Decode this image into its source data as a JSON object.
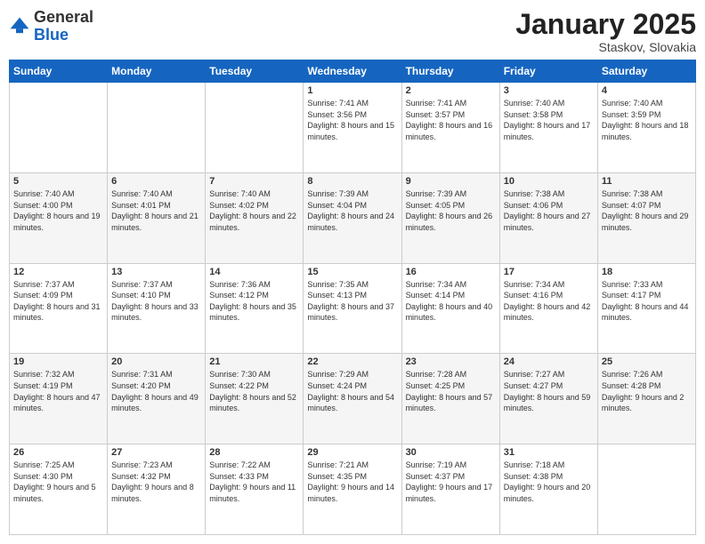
{
  "logo": {
    "general": "General",
    "blue": "Blue"
  },
  "header": {
    "month": "January 2025",
    "location": "Staskov, Slovakia"
  },
  "weekdays": [
    "Sunday",
    "Monday",
    "Tuesday",
    "Wednesday",
    "Thursday",
    "Friday",
    "Saturday"
  ],
  "rows": [
    [
      {
        "day": "",
        "sunrise": "",
        "sunset": "",
        "daylight": ""
      },
      {
        "day": "",
        "sunrise": "",
        "sunset": "",
        "daylight": ""
      },
      {
        "day": "",
        "sunrise": "",
        "sunset": "",
        "daylight": ""
      },
      {
        "day": "1",
        "sunrise": "Sunrise: 7:41 AM",
        "sunset": "Sunset: 3:56 PM",
        "daylight": "Daylight: 8 hours and 15 minutes."
      },
      {
        "day": "2",
        "sunrise": "Sunrise: 7:41 AM",
        "sunset": "Sunset: 3:57 PM",
        "daylight": "Daylight: 8 hours and 16 minutes."
      },
      {
        "day": "3",
        "sunrise": "Sunrise: 7:40 AM",
        "sunset": "Sunset: 3:58 PM",
        "daylight": "Daylight: 8 hours and 17 minutes."
      },
      {
        "day": "4",
        "sunrise": "Sunrise: 7:40 AM",
        "sunset": "Sunset: 3:59 PM",
        "daylight": "Daylight: 8 hours and 18 minutes."
      }
    ],
    [
      {
        "day": "5",
        "sunrise": "Sunrise: 7:40 AM",
        "sunset": "Sunset: 4:00 PM",
        "daylight": "Daylight: 8 hours and 19 minutes."
      },
      {
        "day": "6",
        "sunrise": "Sunrise: 7:40 AM",
        "sunset": "Sunset: 4:01 PM",
        "daylight": "Daylight: 8 hours and 21 minutes."
      },
      {
        "day": "7",
        "sunrise": "Sunrise: 7:40 AM",
        "sunset": "Sunset: 4:02 PM",
        "daylight": "Daylight: 8 hours and 22 minutes."
      },
      {
        "day": "8",
        "sunrise": "Sunrise: 7:39 AM",
        "sunset": "Sunset: 4:04 PM",
        "daylight": "Daylight: 8 hours and 24 minutes."
      },
      {
        "day": "9",
        "sunrise": "Sunrise: 7:39 AM",
        "sunset": "Sunset: 4:05 PM",
        "daylight": "Daylight: 8 hours and 26 minutes."
      },
      {
        "day": "10",
        "sunrise": "Sunrise: 7:38 AM",
        "sunset": "Sunset: 4:06 PM",
        "daylight": "Daylight: 8 hours and 27 minutes."
      },
      {
        "day": "11",
        "sunrise": "Sunrise: 7:38 AM",
        "sunset": "Sunset: 4:07 PM",
        "daylight": "Daylight: 8 hours and 29 minutes."
      }
    ],
    [
      {
        "day": "12",
        "sunrise": "Sunrise: 7:37 AM",
        "sunset": "Sunset: 4:09 PM",
        "daylight": "Daylight: 8 hours and 31 minutes."
      },
      {
        "day": "13",
        "sunrise": "Sunrise: 7:37 AM",
        "sunset": "Sunset: 4:10 PM",
        "daylight": "Daylight: 8 hours and 33 minutes."
      },
      {
        "day": "14",
        "sunrise": "Sunrise: 7:36 AM",
        "sunset": "Sunset: 4:12 PM",
        "daylight": "Daylight: 8 hours and 35 minutes."
      },
      {
        "day": "15",
        "sunrise": "Sunrise: 7:35 AM",
        "sunset": "Sunset: 4:13 PM",
        "daylight": "Daylight: 8 hours and 37 minutes."
      },
      {
        "day": "16",
        "sunrise": "Sunrise: 7:34 AM",
        "sunset": "Sunset: 4:14 PM",
        "daylight": "Daylight: 8 hours and 40 minutes."
      },
      {
        "day": "17",
        "sunrise": "Sunrise: 7:34 AM",
        "sunset": "Sunset: 4:16 PM",
        "daylight": "Daylight: 8 hours and 42 minutes."
      },
      {
        "day": "18",
        "sunrise": "Sunrise: 7:33 AM",
        "sunset": "Sunset: 4:17 PM",
        "daylight": "Daylight: 8 hours and 44 minutes."
      }
    ],
    [
      {
        "day": "19",
        "sunrise": "Sunrise: 7:32 AM",
        "sunset": "Sunset: 4:19 PM",
        "daylight": "Daylight: 8 hours and 47 minutes."
      },
      {
        "day": "20",
        "sunrise": "Sunrise: 7:31 AM",
        "sunset": "Sunset: 4:20 PM",
        "daylight": "Daylight: 8 hours and 49 minutes."
      },
      {
        "day": "21",
        "sunrise": "Sunrise: 7:30 AM",
        "sunset": "Sunset: 4:22 PM",
        "daylight": "Daylight: 8 hours and 52 minutes."
      },
      {
        "day": "22",
        "sunrise": "Sunrise: 7:29 AM",
        "sunset": "Sunset: 4:24 PM",
        "daylight": "Daylight: 8 hours and 54 minutes."
      },
      {
        "day": "23",
        "sunrise": "Sunrise: 7:28 AM",
        "sunset": "Sunset: 4:25 PM",
        "daylight": "Daylight: 8 hours and 57 minutes."
      },
      {
        "day": "24",
        "sunrise": "Sunrise: 7:27 AM",
        "sunset": "Sunset: 4:27 PM",
        "daylight": "Daylight: 8 hours and 59 minutes."
      },
      {
        "day": "25",
        "sunrise": "Sunrise: 7:26 AM",
        "sunset": "Sunset: 4:28 PM",
        "daylight": "Daylight: 9 hours and 2 minutes."
      }
    ],
    [
      {
        "day": "26",
        "sunrise": "Sunrise: 7:25 AM",
        "sunset": "Sunset: 4:30 PM",
        "daylight": "Daylight: 9 hours and 5 minutes."
      },
      {
        "day": "27",
        "sunrise": "Sunrise: 7:23 AM",
        "sunset": "Sunset: 4:32 PM",
        "daylight": "Daylight: 9 hours and 8 minutes."
      },
      {
        "day": "28",
        "sunrise": "Sunrise: 7:22 AM",
        "sunset": "Sunset: 4:33 PM",
        "daylight": "Daylight: 9 hours and 11 minutes."
      },
      {
        "day": "29",
        "sunrise": "Sunrise: 7:21 AM",
        "sunset": "Sunset: 4:35 PM",
        "daylight": "Daylight: 9 hours and 14 minutes."
      },
      {
        "day": "30",
        "sunrise": "Sunrise: 7:19 AM",
        "sunset": "Sunset: 4:37 PM",
        "daylight": "Daylight: 9 hours and 17 minutes."
      },
      {
        "day": "31",
        "sunrise": "Sunrise: 7:18 AM",
        "sunset": "Sunset: 4:38 PM",
        "daylight": "Daylight: 9 hours and 20 minutes."
      },
      {
        "day": "",
        "sunrise": "",
        "sunset": "",
        "daylight": ""
      }
    ]
  ]
}
